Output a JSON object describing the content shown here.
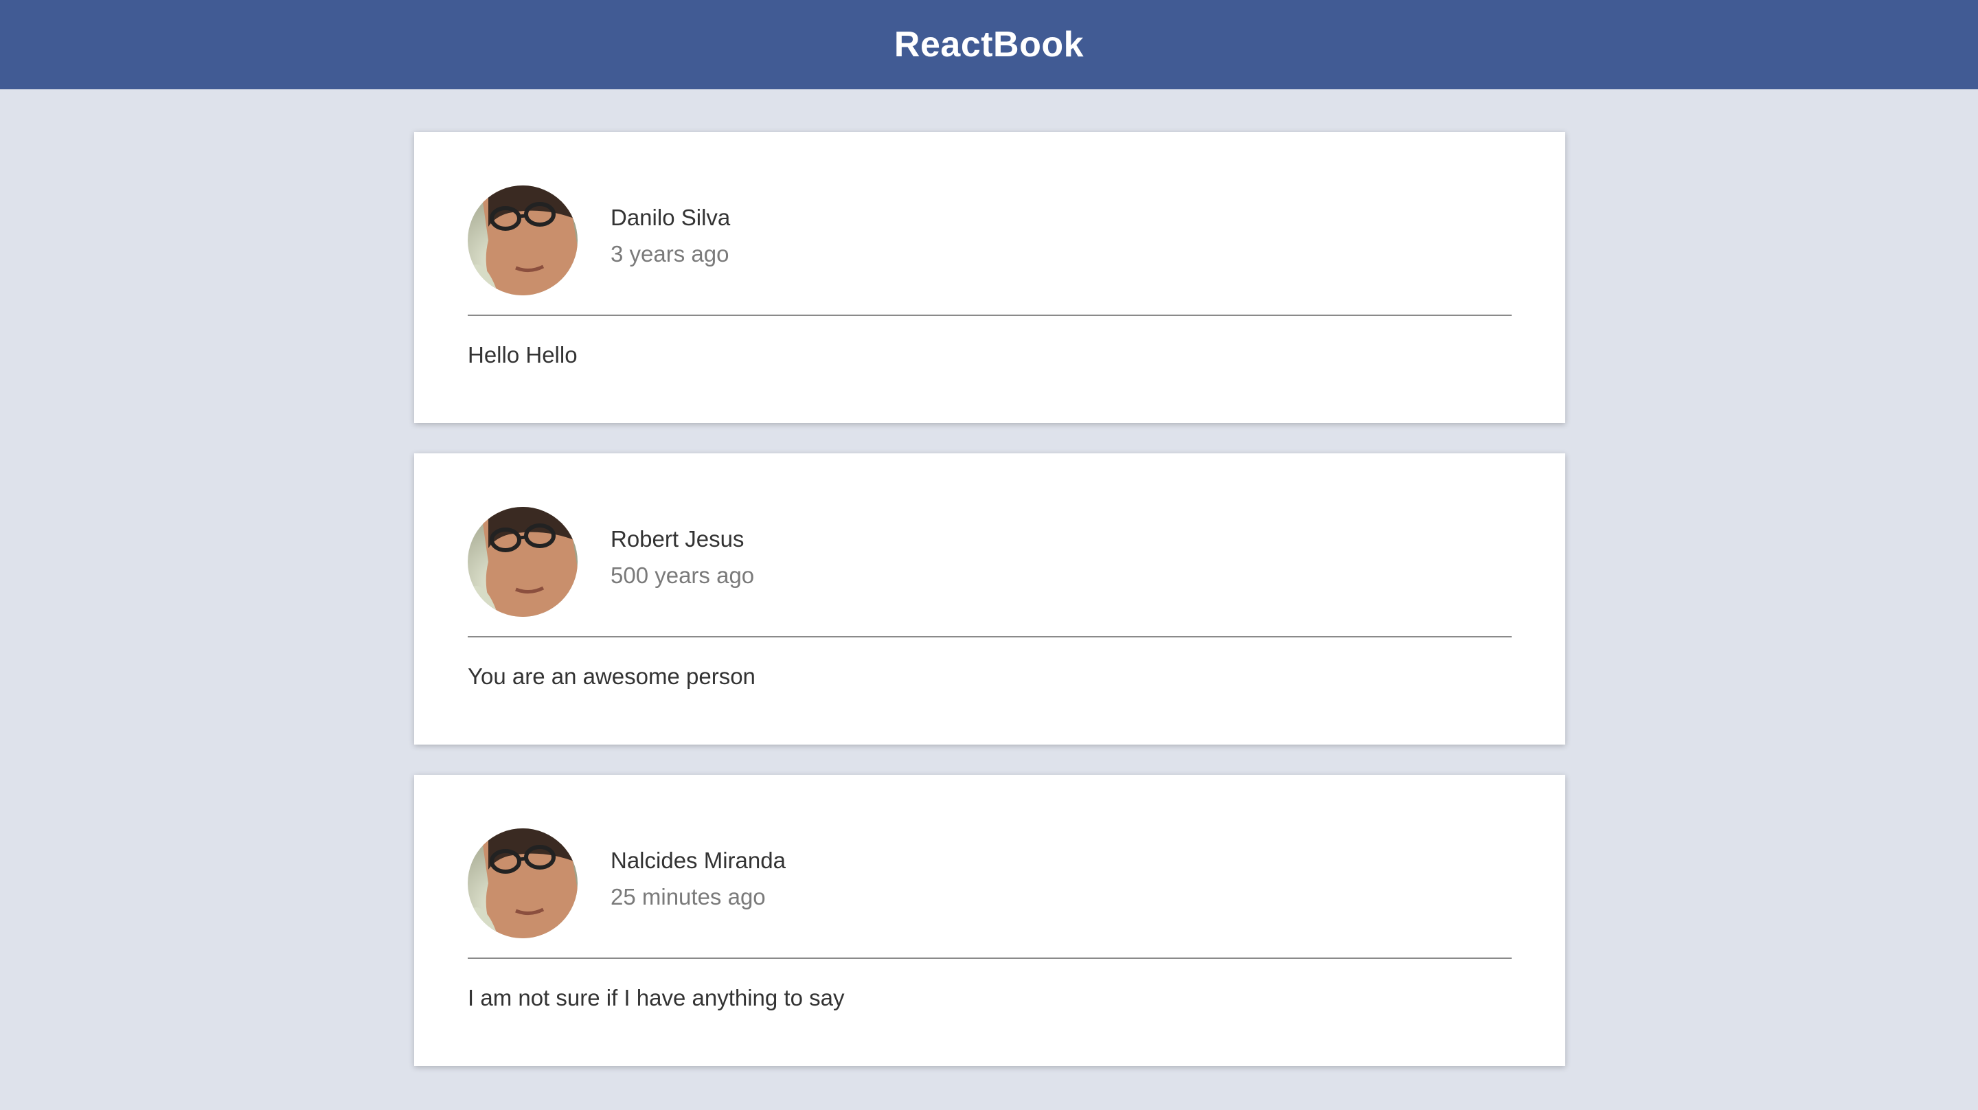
{
  "header": {
    "title": "ReactBook",
    "background": "#415b94"
  },
  "posts": [
    {
      "author": "Danilo Silva",
      "time": "3 years ago",
      "content": "Hello Hello",
      "avatar_icon": "profile-photo"
    },
    {
      "author": "Robert Jesus",
      "time": "500 years ago",
      "content": "You are an awesome person",
      "avatar_icon": "profile-photo"
    },
    {
      "author": "Nalcides Miranda",
      "time": "25 minutes ago",
      "content": "I am not sure if I have anything to say",
      "avatar_icon": "profile-photo"
    }
  ],
  "colors": {
    "page_background": "#dee2eb",
    "card_background": "#ffffff",
    "author_text": "#333333",
    "time_text": "#7a7a7a"
  }
}
